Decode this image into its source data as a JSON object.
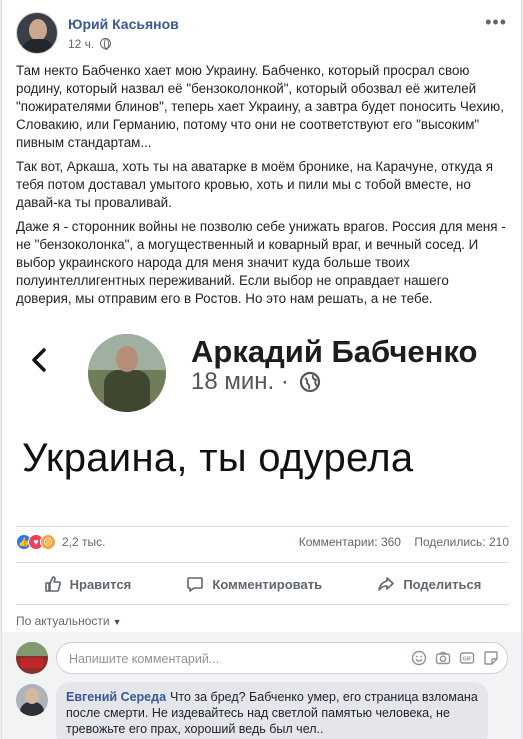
{
  "post": {
    "author": "Юрий Касьянов",
    "time": "12 ч.",
    "paragraphs": [
      "Там некто Бабченко хает мою Украину. Бабченко, который просрал свою родину, который назвал её \"бензоколонкой\", который обозвал её жителей \"пожирателями блинов\", теперь хает Украину, а завтра будет поносить Чехию, Словакию, или Германию, потому что они не соответствуют его \"высоким\" пивным стандартам...",
      "Так вот, Аркаша, хоть ты на аватарке в моём бронике, на Карачуне, откуда я тебя потом доставал умытого кровью, хоть и пили мы с тобой вместе, но давай-ка ты проваливай.",
      "Даже я - сторонник войны не позволю себе унижать врагов. Россия для меня - не \"бензоколонка\", а могущественный и коварный враг, и вечный сосед. И выбор украинского народа для меня значит куда больше твоих полуинтеллигентных переживаний. Если выбор не оправдает нашего доверия, мы отправим его в Ростов. Но это нам решать, а не тебе."
    ]
  },
  "quoted": {
    "name": "Аркадий Бабченко",
    "time": "18 мин. ·",
    "text": "Украина, ты одурела"
  },
  "stats": {
    "reactions_count": "2,2 тыс.",
    "comments": "Комментарии: 360",
    "shares": "Поделились: 210"
  },
  "actions": {
    "like": "Нравится",
    "comment": "Комментировать",
    "share": "Поделиться"
  },
  "sort": {
    "label": "По актуальности",
    "caret": "▼"
  },
  "comment_box": {
    "placeholder": "Напишите комментарий..."
  },
  "first_comment": {
    "author": "Евгений Середа",
    "text": "Что за бред? Бабченко умер, его страница взломана после смерти. Не издевайтесь над светлой памятью человека, не тревожьте его прах, хороший ведь был чел.."
  },
  "colors": {
    "link": "#385898",
    "like_blue": "#2078f4",
    "love_red": "#f33e58",
    "angry_orange": "#f0a640"
  },
  "icons": [
    "more-icon",
    "globe-icon",
    "back-arrow-icon",
    "like-icon",
    "comment-icon",
    "share-icon",
    "emoji-icon",
    "camera-icon",
    "gif-icon",
    "sticker-icon"
  ]
}
